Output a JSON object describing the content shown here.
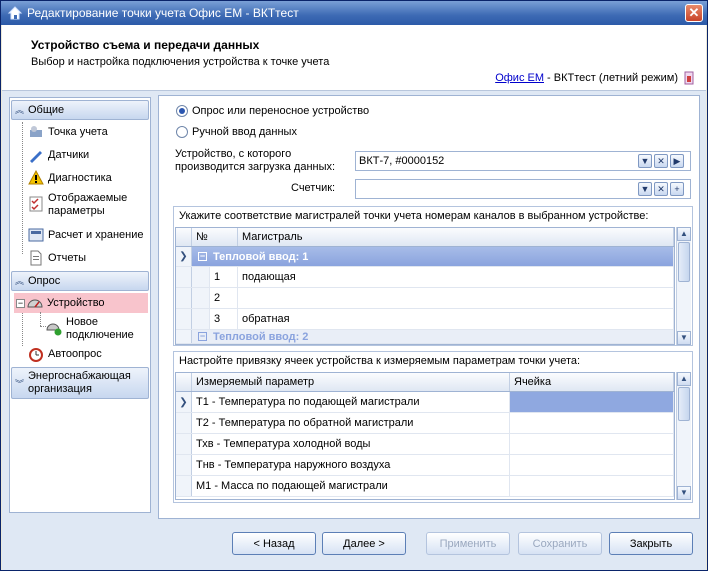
{
  "window": {
    "title": "Редактирование точки учета Офис ЕМ - ВКТтест"
  },
  "header": {
    "title": "Устройство съема и передачи данных",
    "subtitle": "Выбор и настройка подключения устройства к точке учета",
    "link_text": "Офис ЕМ",
    "link_suffix": " - ВКТтест (летний режим)"
  },
  "nav": {
    "group_general": "Общие",
    "items_general": [
      "Точка учета",
      "Датчики",
      "Диагностика",
      "Отображаемые параметры",
      "Расчет и хранение",
      "Отчеты"
    ],
    "group_poll": "Опрос",
    "item_device": "Устройство",
    "item_new_conn": "Новое подключение",
    "item_autopoll": "Автоопрос",
    "group_energy": "Энергоснабжающая организация"
  },
  "form": {
    "radio_poll": "Опрос или переносное устройство",
    "radio_manual": "Ручной ввод данных",
    "device_label": "Устройство, с которого производится загрузка данных:",
    "device_value": "ВКТ-7, #0000152",
    "counter_label": "Счетчик:",
    "counter_value": ""
  },
  "channels": {
    "title": "Укажите соответствие магистралей точки учета номерам каналов в выбранном устройстве:",
    "col_num": "№",
    "col_main": "Магистраль",
    "group1": "Тепловой ввод: 1",
    "rows": [
      {
        "num": "1",
        "main": "подающая"
      },
      {
        "num": "2",
        "main": ""
      },
      {
        "num": "3",
        "main": "обратная"
      }
    ],
    "group2": "Тепловой ввод: 2"
  },
  "cells": {
    "title": "Настройте привязку ячеек устройства к измеряемым параметрам точки учета:",
    "col_param": "Измеряемый параметр",
    "col_cell": "Ячейка",
    "rows": [
      "Т1 - Температура по подающей магистрали",
      "Т2 - Температура по обратной магистрали",
      "Тхв - Температура холодной воды",
      "Тнв - Температура наружного воздуха",
      "М1 - Масса по подающей магистрали"
    ]
  },
  "buttons": {
    "back": "< Назад",
    "next": "Далее >",
    "apply": "Применить",
    "save": "Сохранить",
    "close": "Закрыть"
  },
  "colors": {
    "accent": "#3d6ab4",
    "selection": "#8fa8e0",
    "nav_selected": "#f8c4cc"
  }
}
